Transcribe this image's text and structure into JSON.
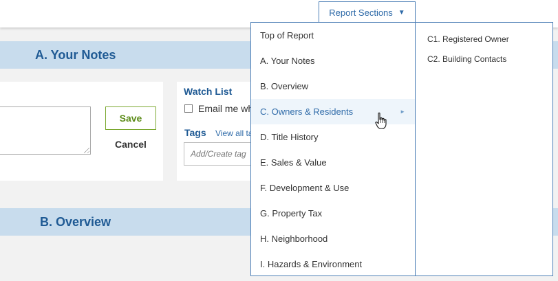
{
  "header": {
    "report_sections_label": "Report Sections",
    "caret_icon": "triangle-down-icon"
  },
  "sections": {
    "a_title": "A. Your Notes",
    "b_title": "B. Overview"
  },
  "notes": {
    "save_label": "Save",
    "cancel_label": "Cancel"
  },
  "watch_list": {
    "title": "Watch List",
    "email_label": "Email me wh",
    "tags_title": "Tags",
    "view_all_label": "View all ta",
    "tag_placeholder": "Add/Create tag"
  },
  "menu": {
    "items": [
      {
        "label": "Top of Report"
      },
      {
        "label": "A. Your Notes"
      },
      {
        "label": "B. Overview"
      },
      {
        "label": "C. Owners & Residents",
        "active": true,
        "has_submenu": true
      },
      {
        "label": "D. Title History"
      },
      {
        "label": "E. Sales & Value"
      },
      {
        "label": "F. Development & Use"
      },
      {
        "label": "G. Property Tax"
      },
      {
        "label": "H. Neighborhood"
      },
      {
        "label": "I. Hazards & Environment"
      }
    ],
    "submenu": [
      {
        "label": "C1. Registered Owner"
      },
      {
        "label": "C2. Building Contacts"
      }
    ]
  },
  "colors": {
    "accent": "#2e6aa8",
    "section_bg": "#c8dced",
    "save_green": "#5d8c1a",
    "active_bg": "#eef5fb"
  }
}
